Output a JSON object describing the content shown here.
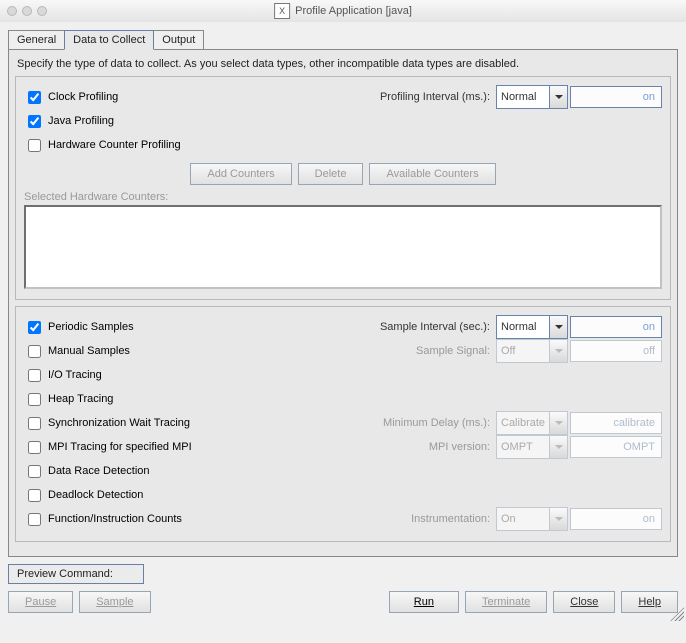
{
  "window": {
    "title": "Profile Application [java]"
  },
  "tabs": {
    "general": "General",
    "collect": "Data to Collect",
    "output": "Output"
  },
  "instr": "Specify the type of data to collect.  As you select data types, other incompatible data types are disabled.",
  "sec1": {
    "clock": "Clock Profiling",
    "java": "Java Profiling",
    "hw": "Hardware Counter Profiling",
    "prof_int_lbl": "Profiling Interval (ms.):",
    "prof_int_val": "Normal",
    "prof_int_unit": "on"
  },
  "hwbtn": {
    "add": "Add Counters",
    "delete": "Delete",
    "avail": "Available Counters"
  },
  "hwcap": "Selected Hardware Counters:",
  "sec2": {
    "per": "Periodic Samples",
    "per_lbl": "Sample Interval (sec.):",
    "per_val": "Normal",
    "per_unit": "on",
    "man": "Manual Samples",
    "man_lbl": "Sample Signal:",
    "man_val": "Off",
    "man_unit": "off",
    "io": "I/O Tracing",
    "heap": "Heap Tracing",
    "sync": "Synchronization Wait Tracing",
    "sync_lbl": "Minimum Delay (ms.):",
    "sync_val": "Calibrate",
    "sync_unit": "calibrate",
    "mpi": "MPI Tracing for specified MPI",
    "mpi_lbl": "MPI version:",
    "mpi_val": "OMPT",
    "mpi_unit": "OMPT",
    "race": "Data Race Detection",
    "dead": "Deadlock Detection",
    "func": "Function/Instruction Counts",
    "func_lbl": "Instrumentation:",
    "func_val": "On",
    "func_unit": "on"
  },
  "preview": "Preview Command:",
  "bottom": {
    "pause": "Pause",
    "sample": "Sample",
    "run": "Run",
    "terminate": "Terminate",
    "close": "Close",
    "help": "Help"
  }
}
